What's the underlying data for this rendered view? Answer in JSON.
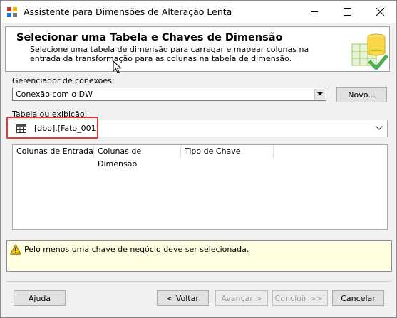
{
  "window": {
    "title": "Assistente para Dimensões de Alteração Lenta"
  },
  "banner": {
    "title": "Selecionar uma Tabela e Chaves de Dimensão",
    "description": "Selecione uma tabela de dimensão para carregar e mapear colunas na entrada da transformação para as colunas na tabela de dimensão."
  },
  "connection": {
    "label": "Gerenciador de conexões:",
    "value": "Conexão com o DW",
    "new_button": "Novo..."
  },
  "table": {
    "label": "Tabela ou exibição:",
    "value": "[dbo].[Fato_001]"
  },
  "columns_list": {
    "headers": [
      "Colunas de Entrada",
      "Colunas de Dimensão",
      "Tipo de Chave"
    ]
  },
  "warning": {
    "text": "Pelo menos uma chave de negócio deve ser selecionada."
  },
  "footer": {
    "help": "Ajuda",
    "back": "< Voltar",
    "next": "Avançar >",
    "finish": "Concluir >>|",
    "cancel": "Cancelar"
  },
  "colors": {
    "highlight": "#e03a3a",
    "warning_bg": "#ffffe1"
  }
}
